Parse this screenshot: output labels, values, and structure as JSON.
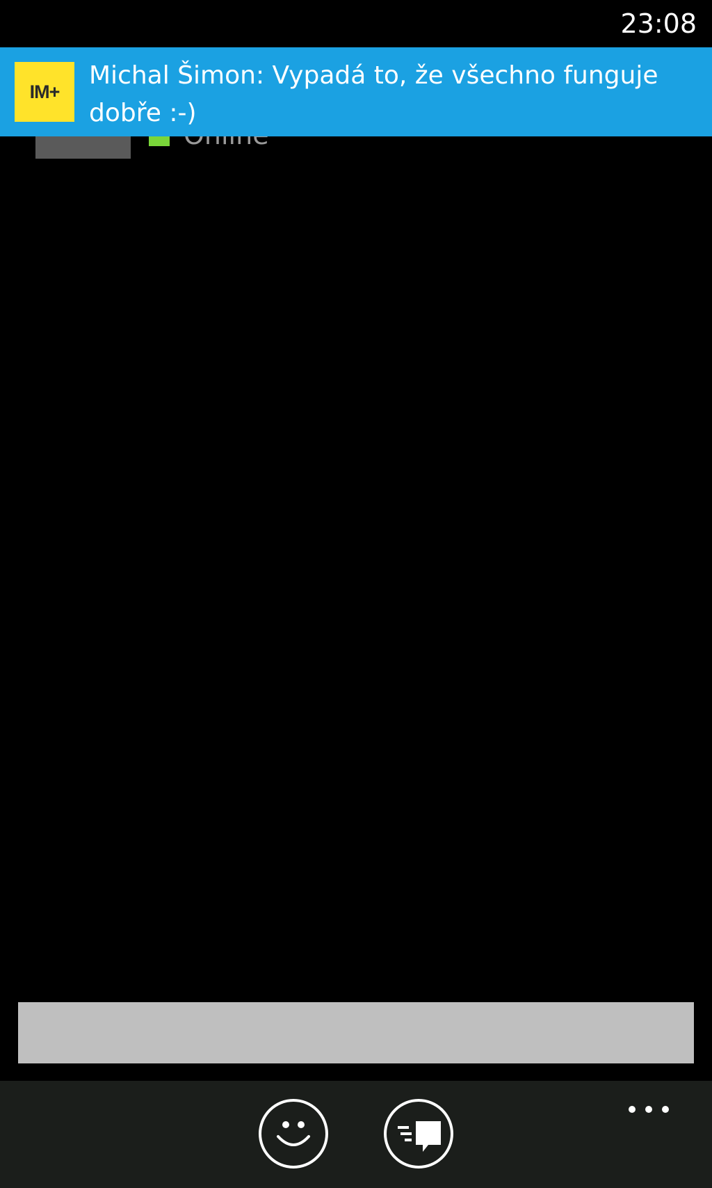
{
  "status_bar": {
    "time": "23:08"
  },
  "toast": {
    "app_logo_text": "IM+",
    "message": "Michal Šimon: Vypadá to, že všechno funguje dobře :-)",
    "background_color": "#1ba1e2",
    "logo_color": "#ffe32a"
  },
  "contact": {
    "presence_text": "Online",
    "presence_color": "#7ad63a"
  },
  "composer": {
    "input_value": ""
  },
  "app_bar": {
    "buttons": [
      {
        "icon": "emoticon-icon"
      },
      {
        "icon": "send-message-icon"
      }
    ],
    "more_icon": "more-ellipsis-icon"
  }
}
